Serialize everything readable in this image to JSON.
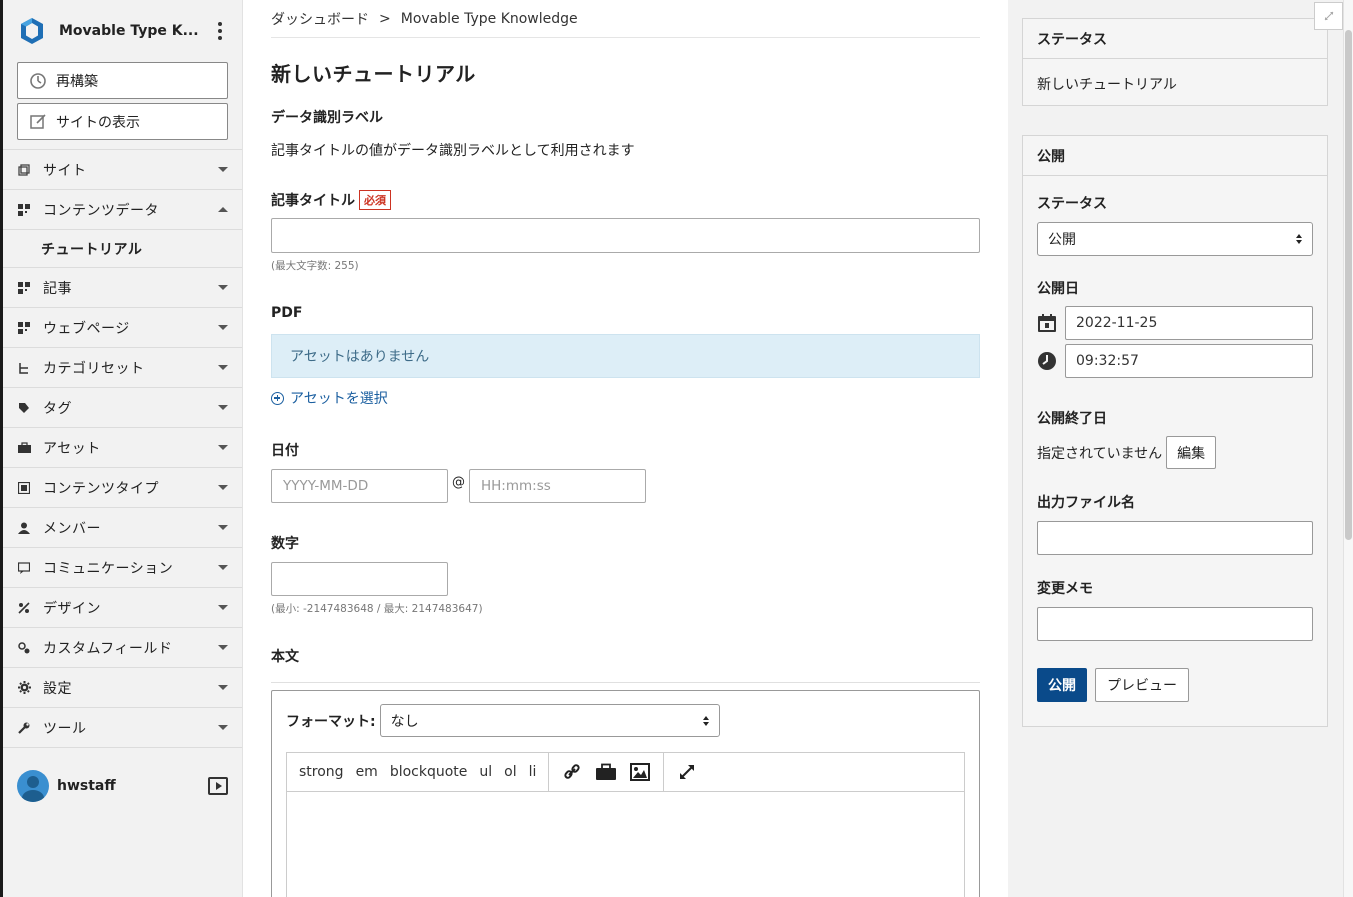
{
  "sidebar": {
    "site_name": "Movable Type K...",
    "rebuild_label": "再構築",
    "view_site_label": "サイトの表示",
    "nav": [
      {
        "label": "サイト",
        "icon": "site-icon",
        "state": "collapsed"
      },
      {
        "label": "コンテンツデータ",
        "icon": "content-data-icon",
        "state": "expanded"
      },
      {
        "label": "記事",
        "icon": "entry-icon",
        "state": "collapsed"
      },
      {
        "label": "ウェブページ",
        "icon": "webpage-icon",
        "state": "collapsed"
      },
      {
        "label": "カテゴリセット",
        "icon": "category-set-icon",
        "state": "collapsed"
      },
      {
        "label": "タグ",
        "icon": "tag-icon",
        "state": "collapsed"
      },
      {
        "label": "アセット",
        "icon": "asset-icon",
        "state": "collapsed"
      },
      {
        "label": "コンテンツタイプ",
        "icon": "content-type-icon",
        "state": "collapsed"
      },
      {
        "label": "メンバー",
        "icon": "member-icon",
        "state": "collapsed"
      },
      {
        "label": "コミュニケーション",
        "icon": "communication-icon",
        "state": "collapsed"
      },
      {
        "label": "デザイン",
        "icon": "design-icon",
        "state": "collapsed"
      },
      {
        "label": "カスタムフィールド",
        "icon": "custom-field-icon",
        "state": "collapsed"
      },
      {
        "label": "設定",
        "icon": "gear-icon",
        "state": "collapsed"
      },
      {
        "label": "ツール",
        "icon": "wrench-icon",
        "state": "collapsed"
      }
    ],
    "sub_item": "チュートリアル",
    "username": "hwstaff"
  },
  "breadcrumb": {
    "home": "ダッシュボード",
    "separator": ">",
    "current": "Movable Type Knowledge"
  },
  "main": {
    "title": "新しいチュートリアル",
    "data_label": {
      "label": "データ識別ラベル",
      "desc": "記事タイトルの値がデータ識別ラベルとして利用されます"
    },
    "title_field": {
      "label": "記事タイトル",
      "required": "必須",
      "value": "",
      "hint": "(最大文字数: 255)"
    },
    "pdf": {
      "label": "PDF",
      "empty": "アセットはありません",
      "select": "アセットを選択"
    },
    "date": {
      "label": "日付",
      "date_placeholder": "YYYY-MM-DD",
      "at": "@",
      "time_placeholder": "HH:mm:ss"
    },
    "number": {
      "label": "数字",
      "hint": "(最小: -2147483648 / 最大: 2147483647)"
    },
    "body": {
      "label": "本文",
      "format_label": "フォーマット:",
      "format_value": "なし",
      "toolbar": [
        "strong",
        "em",
        "blockquote",
        "ul",
        "ol",
        "li"
      ]
    }
  },
  "right": {
    "status_panel": {
      "title": "ステータス",
      "value": "新しいチュートリアル"
    },
    "publish_panel": {
      "title": "公開",
      "status_label": "ステータス",
      "status_value": "公開",
      "pubdate_label": "公開日",
      "date": "2022-11-25",
      "time": "09:32:57",
      "unpub_label": "公開終了日",
      "unpub_value": "指定されていません",
      "edit_label": "編集",
      "basename_label": "出力ファイル名",
      "memo_label": "変更メモ",
      "publish_btn": "公開",
      "preview_btn": "プレビュー"
    }
  },
  "colors": {
    "primary": "#0a4a8a",
    "required": "#cc3322",
    "link": "#1b5fa0",
    "info_bg": "#ddeef7"
  }
}
